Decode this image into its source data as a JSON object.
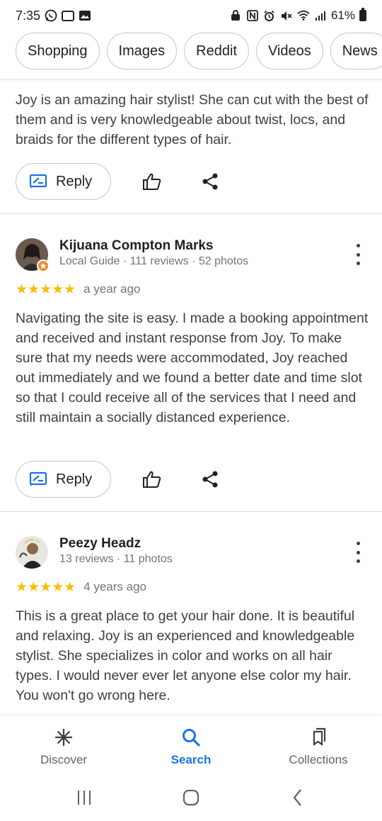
{
  "status_bar": {
    "time": "7:35",
    "battery": "61%"
  },
  "chips": [
    "Shopping",
    "Images",
    "Reddit",
    "Videos",
    "News"
  ],
  "top_review": {
    "text": "Joy is an amazing hair stylist! She can cut with the best of them and is very knowledgeable about twist, locs, and braids for the different types of hair.",
    "reply_label": "Reply"
  },
  "reviews": [
    {
      "name": "Kijuana Compton Marks",
      "meta": "Local Guide · 111 reviews · 52 photos",
      "rating": 5,
      "stars": "★★★★★",
      "date": "a year ago",
      "text": "Navigating the site is easy. I made a booking appointment and received and instant response from Joy. To make sure that my needs were accommodated, Joy reached out immediately and we found a better date and time slot so that I could receive all of the services that I need and still maintain a socially distanced experience.",
      "reply_label": "Reply"
    },
    {
      "name": "Peezy Headz",
      "meta": "13 reviews · 11 photos",
      "rating": 5,
      "stars": "★★★★★",
      "date": "4 years ago",
      "text": "This is a great place to get your hair done. It is beautiful and relaxing. Joy is an experienced and knowledgeable stylist. She specializes in color and works on all hair types. I would never ever let anyone else color my hair. You won't go wrong here."
    }
  ],
  "bottom_nav": {
    "discover": "Discover",
    "search": "Search",
    "collections": "Collections"
  },
  "colors": {
    "accent": "#1a73e8",
    "star": "#fbbc04",
    "reply_icon": "#1a73e8"
  }
}
